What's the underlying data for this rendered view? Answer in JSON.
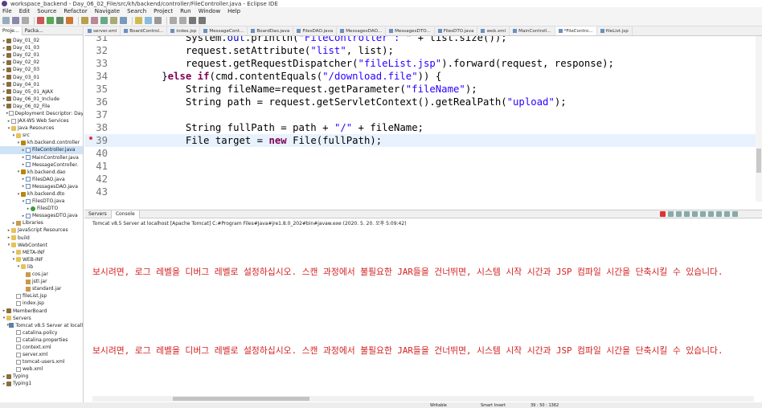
{
  "window": {
    "title": "workspace_backend - Day_06_02_File/src/kh/backend/controller/FileController.java - Eclipse IDE"
  },
  "menu": [
    "File",
    "Edit",
    "Source",
    "Refactor",
    "Navigate",
    "Search",
    "Project",
    "Run",
    "Window",
    "Help"
  ],
  "left_panel": {
    "tabs": [
      "Proje...",
      "Packa..."
    ],
    "tree": [
      {
        "label": "Day_01_02",
        "indent": 0,
        "icon": "project",
        "arrow": "▸"
      },
      {
        "label": "Day_01_03",
        "indent": 0,
        "icon": "project",
        "arrow": "▸"
      },
      {
        "label": "Day_02_01",
        "indent": 0,
        "icon": "project",
        "arrow": "▸"
      },
      {
        "label": "Day_02_02",
        "indent": 0,
        "icon": "project",
        "arrow": "▸"
      },
      {
        "label": "Day_02_03",
        "indent": 0,
        "icon": "project",
        "arrow": "▸"
      },
      {
        "label": "Day_03_01",
        "indent": 0,
        "icon": "project",
        "arrow": "▸"
      },
      {
        "label": "Day_04_01",
        "indent": 0,
        "icon": "project",
        "arrow": "▸"
      },
      {
        "label": "Day_05_01_AJAX",
        "indent": 0,
        "icon": "project",
        "arrow": "▸"
      },
      {
        "label": "Day_06_01_Include",
        "indent": 0,
        "icon": "project",
        "arrow": "▸"
      },
      {
        "label": "Day_06_02_File",
        "indent": 0,
        "icon": "project",
        "arrow": "▾"
      },
      {
        "label": "Deployment Descriptor: Day",
        "indent": 1,
        "icon": "file",
        "arrow": "▸"
      },
      {
        "label": "JAX-WS Web Services",
        "indent": 1,
        "icon": "file",
        "arrow": "▸"
      },
      {
        "label": "Java Resources",
        "indent": 1,
        "icon": "folder",
        "arrow": "▾"
      },
      {
        "label": "src",
        "indent": 2,
        "icon": "folder",
        "arrow": "▾"
      },
      {
        "label": "kh.backend.controller",
        "indent": 3,
        "icon": "pkg",
        "arrow": "▾"
      },
      {
        "label": "FileController.java",
        "indent": 4,
        "icon": "java",
        "arrow": "▸",
        "selected": true
      },
      {
        "label": "MainController.java",
        "indent": 4,
        "icon": "java",
        "arrow": "▸"
      },
      {
        "label": "MessageController.",
        "indent": 4,
        "icon": "java",
        "arrow": "▸"
      },
      {
        "label": "kh.backend.dao",
        "indent": 3,
        "icon": "pkg",
        "arrow": "▾"
      },
      {
        "label": "FilesDAO.java",
        "indent": 4,
        "icon": "java",
        "arrow": "▸"
      },
      {
        "label": "MessagesDAO.java",
        "indent": 4,
        "icon": "java",
        "arrow": "▸"
      },
      {
        "label": "kh.backend.dto",
        "indent": 3,
        "icon": "pkg",
        "arrow": "▾"
      },
      {
        "label": "FilesDTO.java",
        "indent": 4,
        "icon": "java",
        "arrow": "▾"
      },
      {
        "label": "FilesDTO",
        "indent": 5,
        "icon": "cls",
        "arrow": "▸"
      },
      {
        "label": "MessagesDTO.java",
        "indent": 4,
        "icon": "java",
        "arrow": "▸"
      },
      {
        "label": "Libraries",
        "indent": 2,
        "icon": "lib",
        "arrow": "▸"
      },
      {
        "label": "JavaScript Resources",
        "indent": 1,
        "icon": "folder",
        "arrow": "▸"
      },
      {
        "label": "build",
        "indent": 1,
        "icon": "folder",
        "arrow": "▸"
      },
      {
        "label": "WebContent",
        "indent": 1,
        "icon": "folder",
        "arrow": "▾"
      },
      {
        "label": "META-INF",
        "indent": 2,
        "icon": "folder",
        "arrow": "▸"
      },
      {
        "label": "WEB-INF",
        "indent": 2,
        "icon": "folder",
        "arrow": "▾"
      },
      {
        "label": "lib",
        "indent": 3,
        "icon": "folder",
        "arrow": "▾"
      },
      {
        "label": "cos.jar",
        "indent": 4,
        "icon": "lib",
        "arrow": ""
      },
      {
        "label": "jstl.jar",
        "indent": 4,
        "icon": "lib",
        "arrow": ""
      },
      {
        "label": "standard.jar",
        "indent": 4,
        "icon": "lib",
        "arrow": ""
      },
      {
        "label": "fileList.jsp",
        "indent": 2,
        "icon": "file",
        "arrow": ""
      },
      {
        "label": "index.jsp",
        "indent": 2,
        "icon": "file",
        "arrow": ""
      },
      {
        "label": "MemberBoard",
        "indent": 0,
        "icon": "project",
        "arrow": "▸"
      },
      {
        "label": "Servers",
        "indent": 0,
        "icon": "folder",
        "arrow": "▾"
      },
      {
        "label": "Tomcat v8.5 Server at locall",
        "indent": 1,
        "icon": "server",
        "arrow": "▾"
      },
      {
        "label": "catalina.policy",
        "indent": 2,
        "icon": "file",
        "arrow": ""
      },
      {
        "label": "catalina.properties",
        "indent": 2,
        "icon": "file",
        "arrow": ""
      },
      {
        "label": "context.xml",
        "indent": 2,
        "icon": "file",
        "arrow": ""
      },
      {
        "label": "server.xml",
        "indent": 2,
        "icon": "file",
        "arrow": ""
      },
      {
        "label": "tomcat-users.xml",
        "indent": 2,
        "icon": "file",
        "arrow": ""
      },
      {
        "label": "web.xml",
        "indent": 2,
        "icon": "file",
        "arrow": ""
      },
      {
        "label": "Typing",
        "indent": 0,
        "icon": "project",
        "arrow": "▸"
      },
      {
        "label": "Typing1",
        "indent": 0,
        "icon": "project",
        "arrow": "▸"
      }
    ]
  },
  "editor_tabs": [
    {
      "label": "server.xml",
      "active": false
    },
    {
      "label": "BoardControl...",
      "active": false
    },
    {
      "label": "index.jsp",
      "active": false
    },
    {
      "label": "MessageCont...",
      "active": false
    },
    {
      "label": "BoardDao.java",
      "active": false
    },
    {
      "label": "FilesDAO.java",
      "active": false
    },
    {
      "label": "MessagesDAO...",
      "active": false
    },
    {
      "label": "MessagesDTO...",
      "active": false
    },
    {
      "label": "FilesDTO.java",
      "active": false
    },
    {
      "label": "web.xml",
      "active": false
    },
    {
      "label": "MainControll...",
      "active": false
    },
    {
      "label": "*FileContro...",
      "active": true
    },
    {
      "label": "fileList.jsp",
      "active": false
    }
  ],
  "code_lines": [
    {
      "num": "31",
      "html": "            System.<span class='fld'>out</span>.println(<span class='str'>\"FileController : \"</span> + list.size());"
    },
    {
      "num": "32",
      "html": "            request.setAttribute(<span class='str'>\"list\"</span>, list);"
    },
    {
      "num": "33",
      "html": "            request.getRequestDispatcher(<span class='str'>\"fileList.jsp\"</span>).forward(request, response);"
    },
    {
      "num": "34",
      "html": "        }<span class='kw'>else</span> <span class='kw'>if</span>(cmd.contentEquals(<span class='str'>\"/download.file\"</span>)) {"
    },
    {
      "num": "35",
      "html": "            String fileName=request.getParameter(<span class='str'>\"fileName\"</span>);"
    },
    {
      "num": "36",
      "html": "            String path = request.getServletContext().getRealPath(<span class='str'>\"upload\"</span>);"
    },
    {
      "num": "37",
      "html": ""
    },
    {
      "num": "38",
      "html": "            String fullPath = path + <span class='str'>\"/\"</span> + fileName;"
    },
    {
      "num": "39",
      "html": "            File target = <span class='kw'>new</span> File(fullPath);",
      "current": true
    },
    {
      "num": "40",
      "html": ""
    },
    {
      "num": "41",
      "html": ""
    },
    {
      "num": "42",
      "html": ""
    },
    {
      "num": "43",
      "html": ""
    }
  ],
  "console": {
    "tabs": [
      "Servers",
      "Console"
    ],
    "description": "Tomcat v8.5 Server at localhost [Apache Tomcat] C:#Program Files#Java#jre1.8.0_202#bin#javaw.exe (2020. 5. 20. 오후 5:09:42)",
    "lines": [
      "보시려면, 로그 레벨을 디버그 레벨로 설정하십시오. 스캔 과정에서 불필요한 JAR들을 건너뛰면, 시스템 시작 시간과 JSP 컴파일 시간을 단축시킬 수 있습니다.",
      "보시려면, 로그 레벨을 디버그 레벨로 설정하십시오. 스캔 과정에서 불필요한 JAR들을 건너뛰면, 시스템 시작 시간과 JSP 컴파일 시간을 단축시킬 수 있습니다."
    ]
  },
  "status": {
    "writable": "Writable",
    "insert": "Smart Insert",
    "position": "39 : 50 : 1362"
  }
}
